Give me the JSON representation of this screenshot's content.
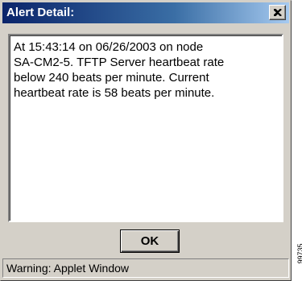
{
  "window": {
    "title": "Alert Detail:",
    "close_icon": "close-x-icon"
  },
  "message": {
    "text": "At 15:43:14 on 06/26/2003 on node\nSA-CM2-5. TFTP Server heartbeat rate\nbelow 240 beats per minute. Current\nheartbeat rate is 58 beats per minute."
  },
  "buttons": {
    "ok_label": "OK"
  },
  "status": {
    "text": "Warning: Applet Window"
  },
  "figure_id": "99735",
  "colors": {
    "title_start": "#0a246a",
    "title_end": "#a6caf0",
    "face": "#d4d0c8"
  }
}
